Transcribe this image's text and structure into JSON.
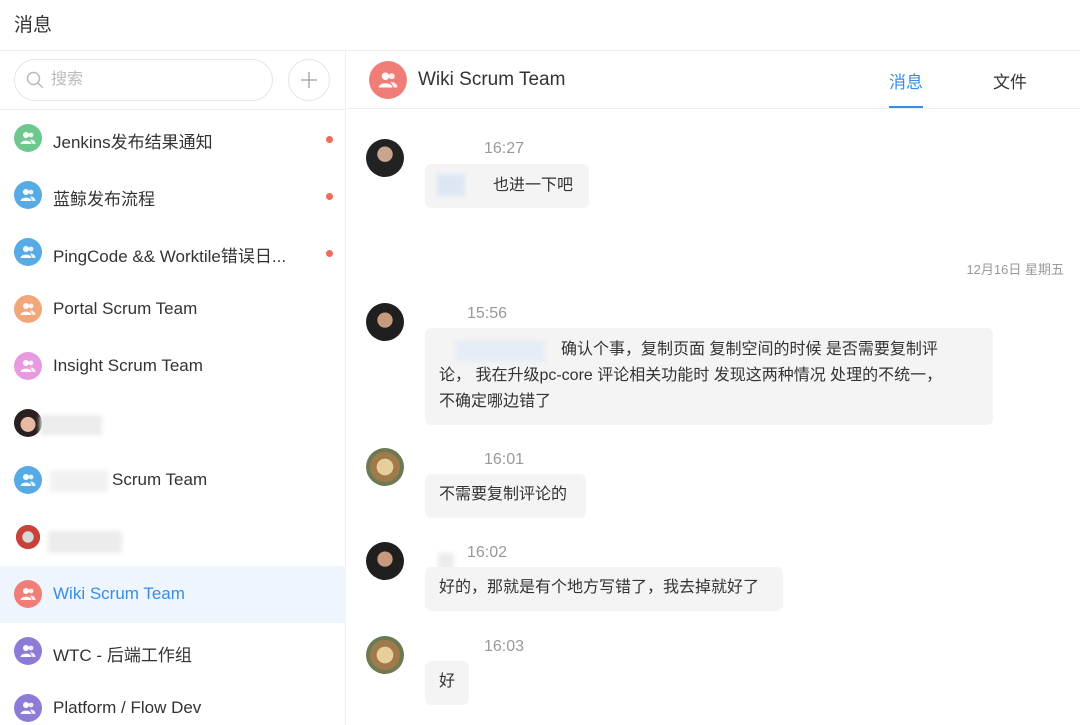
{
  "app": {
    "title": "消息"
  },
  "search": {
    "placeholder": "搜索"
  },
  "conversations": [
    {
      "name": "Jenkins发布结果通知",
      "color": "#6dc88d",
      "unread": true
    },
    {
      "name": "蓝鲸发布流程",
      "color": "#56abe4",
      "unread": true
    },
    {
      "name": "PingCode && Worktile错误日...",
      "color": "#56abe4",
      "unread": true
    },
    {
      "name": "Portal Scrum Team",
      "color": "#f2a77a",
      "unread": false
    },
    {
      "name": "Insight Scrum Team",
      "color": "#e89ae0",
      "unread": false
    },
    {
      "name": "",
      "color": "",
      "unread": false
    },
    {
      "name": "Scrum Team",
      "color": "#56abe4",
      "unread": false
    },
    {
      "name": "",
      "color": "",
      "unread": false
    },
    {
      "name": "Wiki Scrum Team",
      "color": "#f07d78",
      "unread": false
    },
    {
      "name": "WTC - 后端工作组",
      "color": "#8e7bd8",
      "unread": false
    },
    {
      "name": "Platform / Flow Dev",
      "color": "#8e7bd8",
      "unread": false
    }
  ],
  "chat": {
    "title": "Wiki Scrum Team",
    "header_color": "#f07d78",
    "tabs": {
      "messages": "消息",
      "files": "文件"
    },
    "date_separator": "12月16日 星期五",
    "messages": [
      {
        "time": "16:27",
        "lines": [
          "也进一下吧"
        ]
      },
      {
        "time": "15:56",
        "lines": [
          "确认个事，复制页面 复制空间的时候 是否需要复制评",
          "论， 我在升级pc-core 评论相关功能时 发现这两种情况 处理的不统一，",
          "不确定哪边错了"
        ]
      },
      {
        "time": "16:01",
        "lines": [
          "不需要复制评论的"
        ]
      },
      {
        "time": "16:02",
        "lines": [
          "好的，那就是有个地方写错了，我去掉就好了"
        ]
      },
      {
        "time": "16:03",
        "lines": [
          "好"
        ]
      }
    ]
  },
  "colors": {
    "accent": "#348fe4",
    "active_bg": "#eef5fc",
    "unread_dot": "#f06b5b",
    "bubble_bg": "#f4f4f4"
  },
  "icons": {
    "search": "search-icon",
    "add": "plus-icon",
    "group": "group-icon"
  }
}
